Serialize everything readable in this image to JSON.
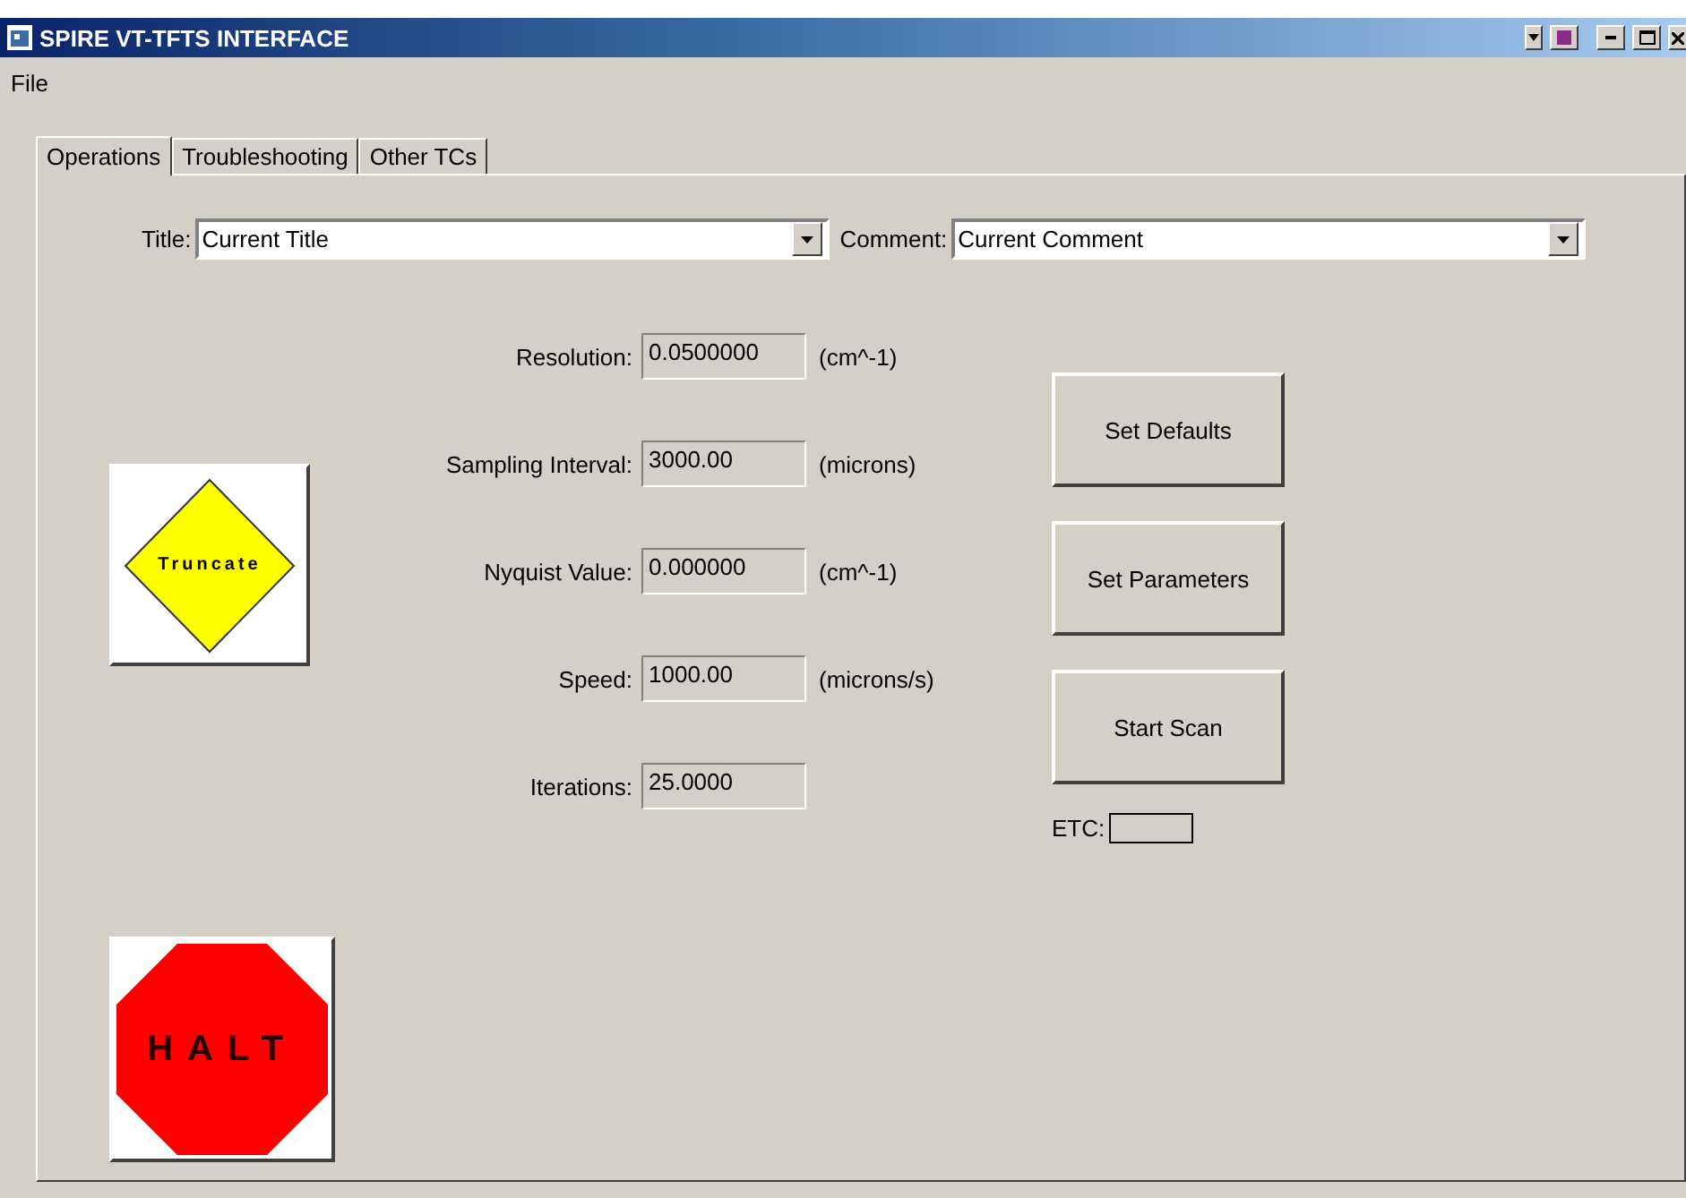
{
  "window": {
    "title": "SPIRE VT-TFTS INTERFACE"
  },
  "menu": [
    "File"
  ],
  "tabs": [
    {
      "label": "Operations",
      "selected": true
    },
    {
      "label": "Troubleshooting",
      "selected": false
    },
    {
      "label": "Other TCs",
      "selected": false
    }
  ],
  "combos": [
    {
      "label": "Title:",
      "value": "Current Title"
    },
    {
      "label": "Comment:",
      "value": "Current Comment"
    }
  ],
  "truncate_button": {
    "label": "Truncate"
  },
  "halt_button": {
    "label": "HALT"
  },
  "fields": [
    {
      "label": "Resolution:",
      "value": "0.0500000",
      "unit": "(cm^-1)"
    },
    {
      "label": "Sampling Interval:",
      "value": "3000.00",
      "unit": "(microns)"
    },
    {
      "label": "Nyquist Value:",
      "value": "0.000000",
      "unit": "(cm^-1)"
    },
    {
      "label": "Speed:",
      "value": "1000.00",
      "unit": "(microns/s)"
    },
    {
      "label": "Iterations:",
      "value": "25.0000"
    }
  ],
  "buttons": [
    "Set Defaults",
    "Set Parameters",
    "Start Scan"
  ],
  "etc": {
    "label": "ETC:"
  }
}
